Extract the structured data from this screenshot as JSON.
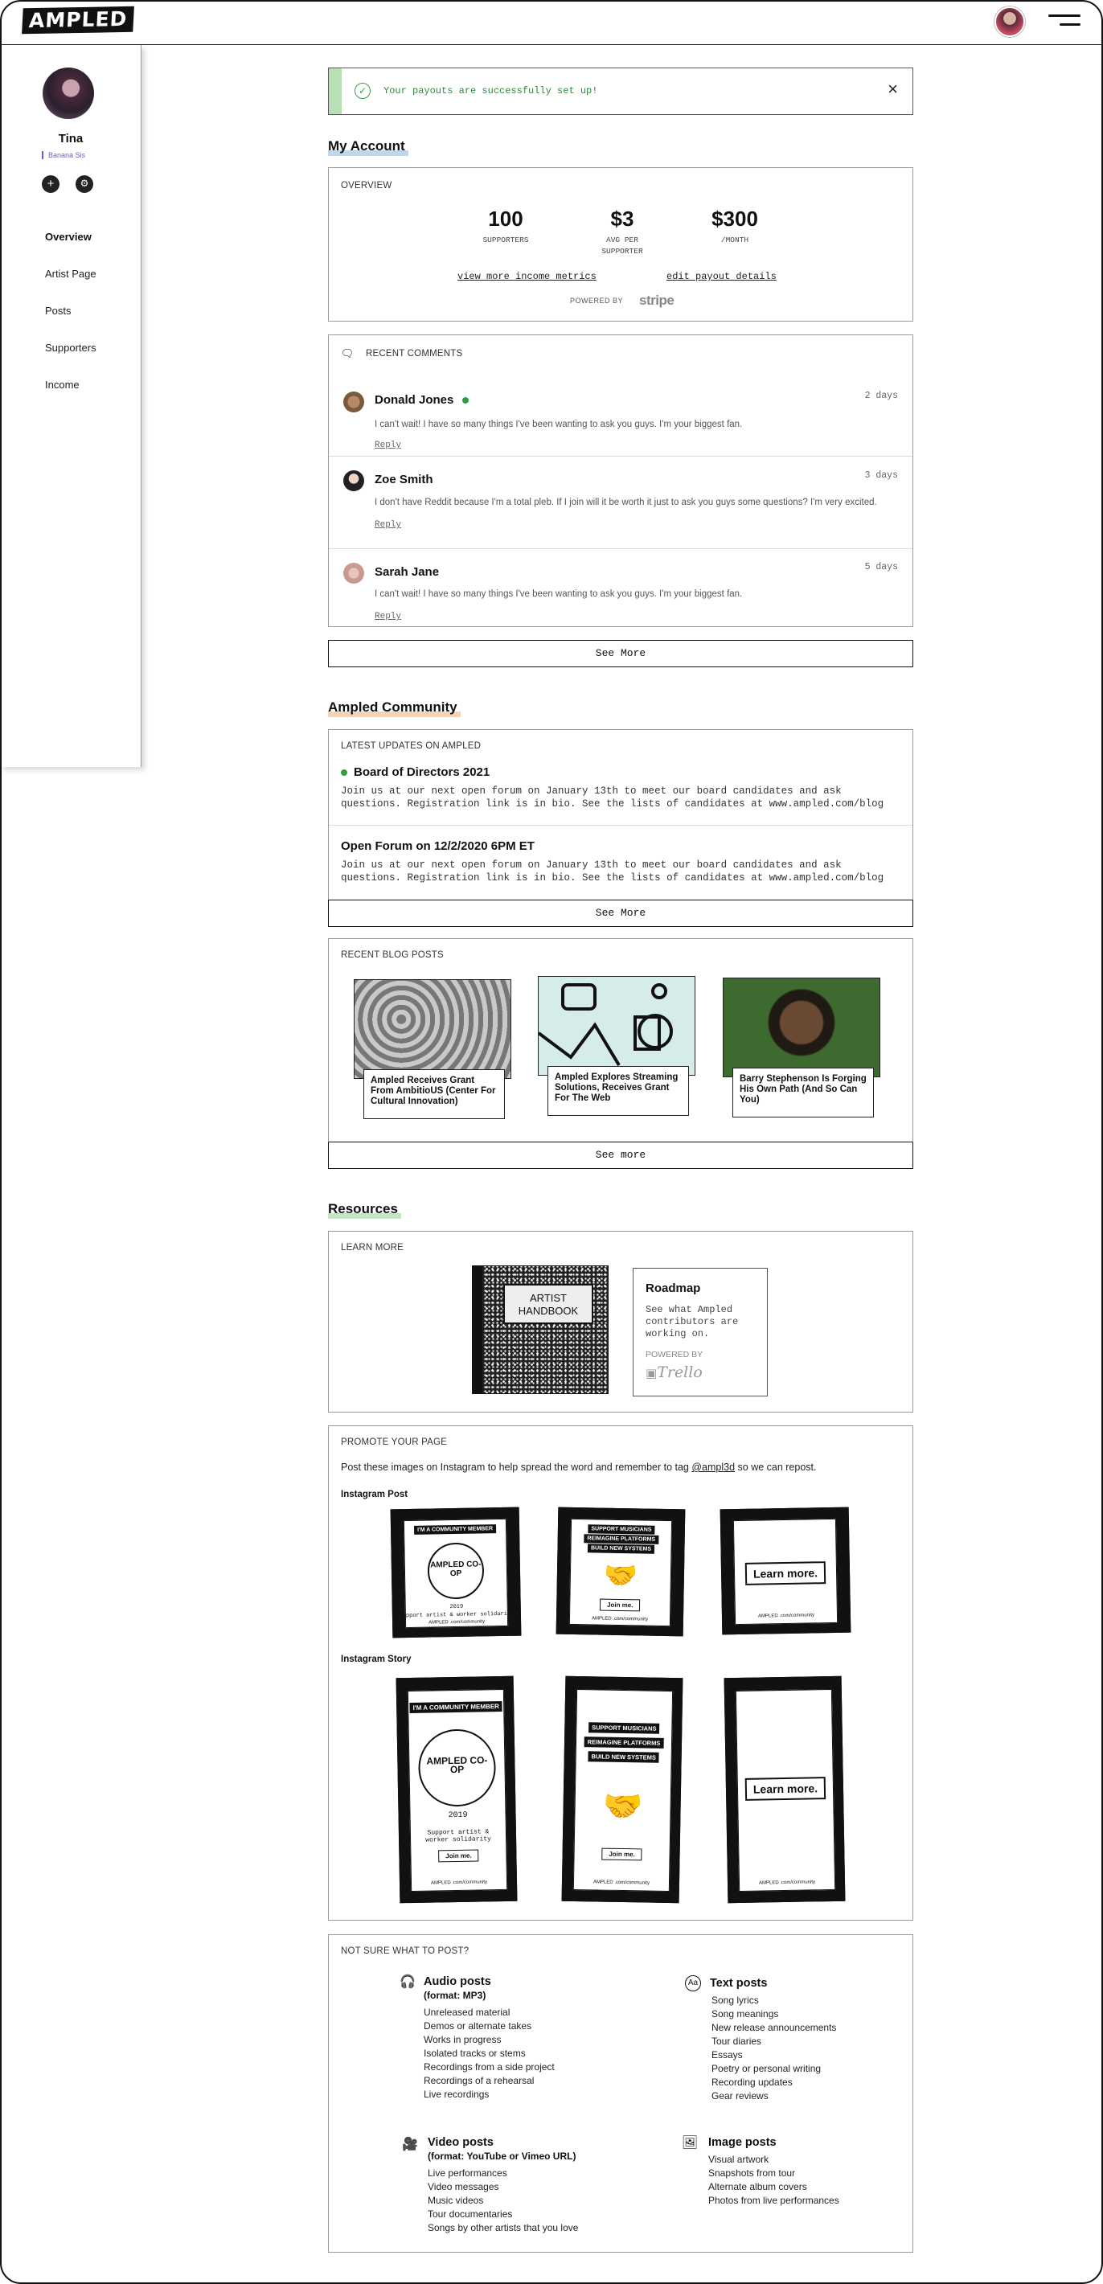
{
  "app": {
    "logo": "AMPLED"
  },
  "sidebar": {
    "name": "Tina",
    "subtitle": "Banana Sis",
    "items": [
      {
        "label": "Overview",
        "active": true
      },
      {
        "label": "Artist Page"
      },
      {
        "label": "Posts"
      },
      {
        "label": "Supporters"
      },
      {
        "label": "Income"
      }
    ]
  },
  "alert": {
    "message": "Your payouts are successfully set up!",
    "close": "×",
    "check": "✓"
  },
  "account": {
    "title": "My Account",
    "overview_label": "OVERVIEW",
    "stats": [
      {
        "value": "100",
        "label": "SUPPORTERS"
      },
      {
        "value": "$3",
        "label": "AVG PER SUPPORTER"
      },
      {
        "value": "$300",
        "label": "/MONTH"
      }
    ],
    "metrics_link": "view more income metrics",
    "payout_link": "edit payout details",
    "powered_by": "POWERED BY",
    "stripe": "stripe"
  },
  "comments": {
    "label": "RECENT COMMENTS",
    "see_more": "See More",
    "items": [
      {
        "name": "Donald Jones",
        "time": "2 days",
        "text": "I can't wait! I have so many things I've been wanting to ask you guys. I'm your biggest fan.",
        "reply": "Reply",
        "online": true
      },
      {
        "name": "Zoe Smith",
        "time": "3 days",
        "text": "I don't have Reddit because I'm a total pleb. If I join will it be worth it just to ask you guys some questions? I'm very excited.",
        "reply": "Reply"
      },
      {
        "name": "Sarah Jane",
        "time": "5 days",
        "text": "I can't wait! I have so many things I've been wanting to ask you guys. I'm your biggest fan.",
        "reply": "Reply"
      }
    ]
  },
  "community": {
    "title": "Ampled Community",
    "updates_label": "LATEST UPDATES ON AMPLED",
    "see_more": "See More",
    "updates": [
      {
        "title": "Board of Directors 2021",
        "text": "Join us at our next open forum on January 13th to meet our board candidates and ask questions. Registration link is in bio. See the lists of candidates at www.ampled.com/blog"
      },
      {
        "title": "Open Forum on 12/2/2020 6PM ET",
        "text": "Join us at our next open forum on January 13th to meet our board candidates and ask questions. Registration link is in bio. See the lists of candidates at www.ampled.com/blog"
      }
    ],
    "blog_label": "RECENT BLOG POSTS",
    "blog_more": "See more",
    "posts": [
      {
        "title": "Ampled Receives Grant From AmbitioUS (Center For Cultural Innovation)"
      },
      {
        "title": "Ampled Explores Streaming Solutions, Receives Grant For The Web"
      },
      {
        "title": "Barry Stephenson Is Forging His Own Path (And So Can You)"
      }
    ]
  },
  "resources": {
    "title": "Resources",
    "learn_label": "LEARN MORE",
    "handbook": "ARTIST HANDBOOK",
    "roadmap": {
      "title": "Roadmap",
      "text": "See what Ampled contributors are working on.",
      "powered": "POWERED BY",
      "trello": "Trello"
    }
  },
  "promote": {
    "label": "PROMOTE YOUR PAGE",
    "text_before": "Post these images on Instagram to help spread the word and remember to tag ",
    "handle": "@ampl3d",
    "text_after": " so we can repost.",
    "instagram_post": "Instagram Post",
    "instagram_story": "Instagram Story",
    "tile_member": "I'M A COMMUNITY MEMBER",
    "tile_support": [
      "SUPPORT MUSICIANS",
      "REIMAGINE PLATFORMS",
      "BUILD NEW SYSTEMS"
    ],
    "coin": "AMPLED CO-OP",
    "coin_year": "2019",
    "solidarity": "Support artist & worker solidarity",
    "join": "Join me.",
    "learn": "Learn more.",
    "footer": "AMPLED .com/community"
  },
  "tips": {
    "label": "NOT SURE WHAT TO POST?",
    "audio": {
      "title": "Audio posts",
      "format": "(format: MP3)",
      "items": [
        "Unreleased material",
        "Demos or alternate takes",
        "Works in progress",
        "Isolated tracks or stems",
        "Recordings from a side project",
        "Recordings of a rehearsal",
        "Live recordings"
      ]
    },
    "text": {
      "title": "Text posts",
      "items": [
        "Song lyrics",
        "Song meanings",
        "New release announcements",
        "Tour diaries",
        "Essays",
        "Poetry or personal writing",
        "Recording updates",
        "Gear reviews"
      ]
    },
    "video": {
      "title": "Video posts",
      "format": "(format: YouTube or Vimeo URL)",
      "items": [
        "Live performances",
        "Video messages",
        "Music videos",
        "Tour documentaries",
        "Songs by other artists that you love"
      ]
    },
    "image": {
      "title": "Image posts",
      "items": [
        "Visual artwork",
        "Snapshots from tour",
        "Alternate album covers",
        "Photos from live performances"
      ]
    }
  }
}
